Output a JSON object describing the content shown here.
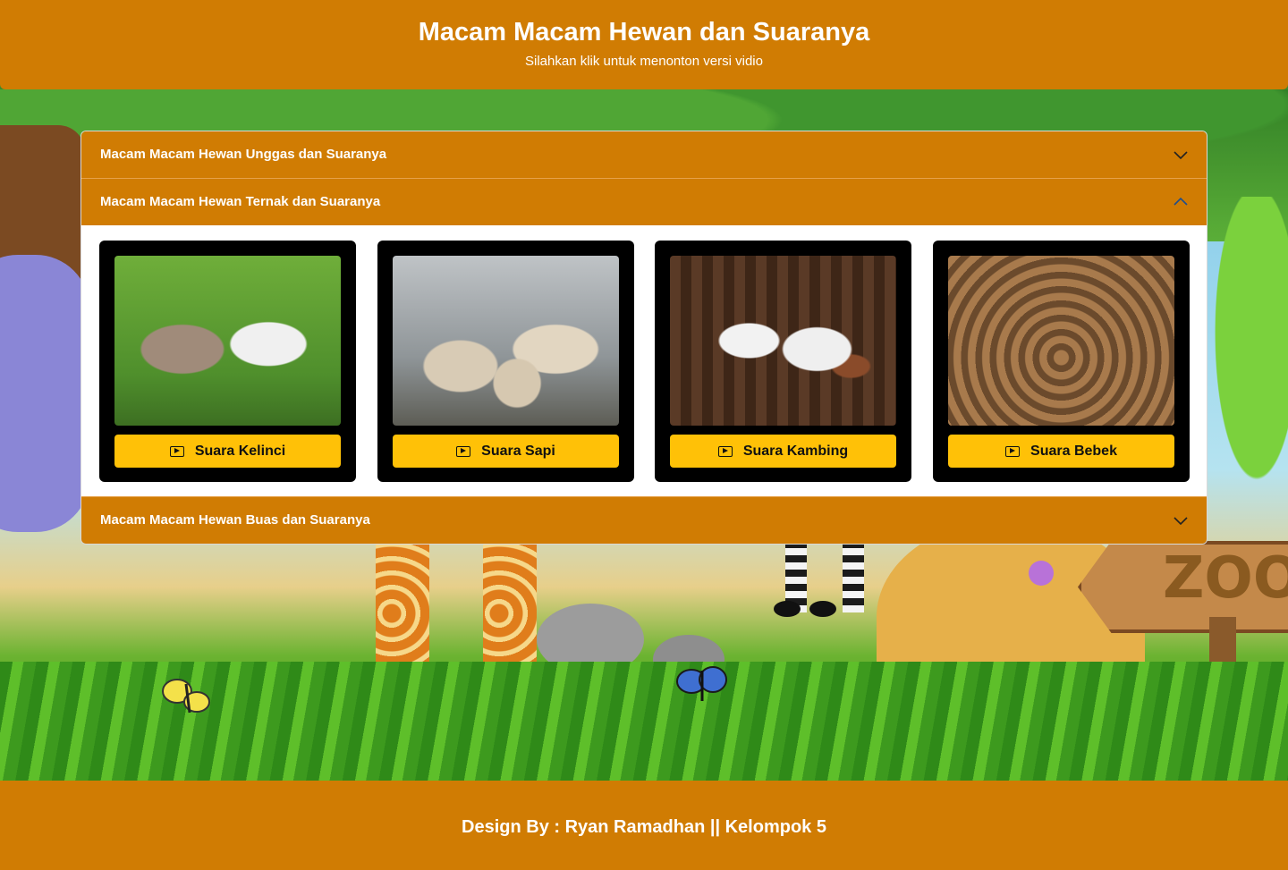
{
  "header": {
    "title": "Macam Macam Hewan dan Suaranya",
    "subtitle": "Silahkan klik untuk menonton versi vidio"
  },
  "background": {
    "sign_text": "ZOO"
  },
  "accordion": {
    "sections": [
      {
        "label": "Macam Macam Hewan Unggas dan Suaranya",
        "expanded": false,
        "chevron_icon": "chevron-down-icon"
      },
      {
        "label": "Macam Macam Hewan Ternak dan Suaranya",
        "expanded": true,
        "chevron_icon": "chevron-up-icon"
      },
      {
        "label": "Macam Macam Hewan Buas dan Suaranya",
        "expanded": false,
        "chevron_icon": "chevron-down-icon"
      }
    ],
    "cards": [
      {
        "animal": "rabbit",
        "button_label": "Suara Kelinci",
        "icon": "play-video-icon"
      },
      {
        "animal": "cow",
        "button_label": "Suara Sapi",
        "icon": "play-video-icon"
      },
      {
        "animal": "goat",
        "button_label": "Suara Kambing",
        "icon": "play-video-icon"
      },
      {
        "animal": "duck",
        "button_label": "Suara Bebek",
        "icon": "play-video-icon"
      }
    ]
  },
  "footer": {
    "credit": "Design By : Ryan Ramadhan || Kelompok 5"
  },
  "colors": {
    "brand_orange": "#d07c03",
    "button_yellow": "#ffc107",
    "card_black": "#000000"
  }
}
